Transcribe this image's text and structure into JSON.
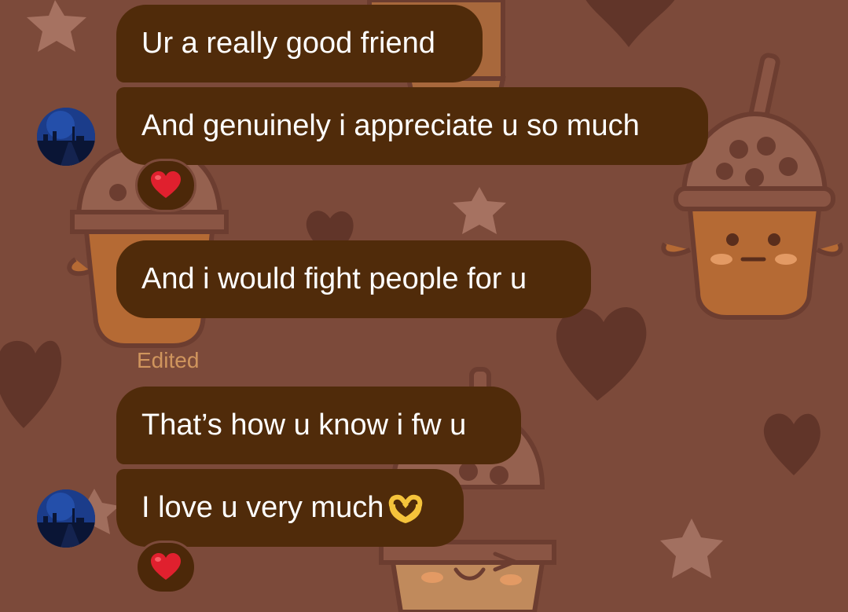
{
  "messages": [
    {
      "text": "Ur a really good friend"
    },
    {
      "text": "And genuinely i appreciate u so much",
      "reaction": "heart-emoji"
    },
    {
      "text": "And i would fight people for u"
    },
    {
      "edited_label": "Edited",
      "text": "That’s how u know i fw u"
    },
    {
      "text": "I love u very much",
      "emoji": "heart-hands-emoji",
      "reaction": "heart-emoji"
    }
  ],
  "colors": {
    "background": "#7c4a3a",
    "bubble": "#502b0a",
    "bubble_text": "#ffffff",
    "edited_text": "#d0955d",
    "reaction_bg": "#4c2809",
    "heart": "#e0202e"
  },
  "wallpaper_icons": [
    "boba-cup-icon",
    "heart-icon",
    "star-icon"
  ]
}
